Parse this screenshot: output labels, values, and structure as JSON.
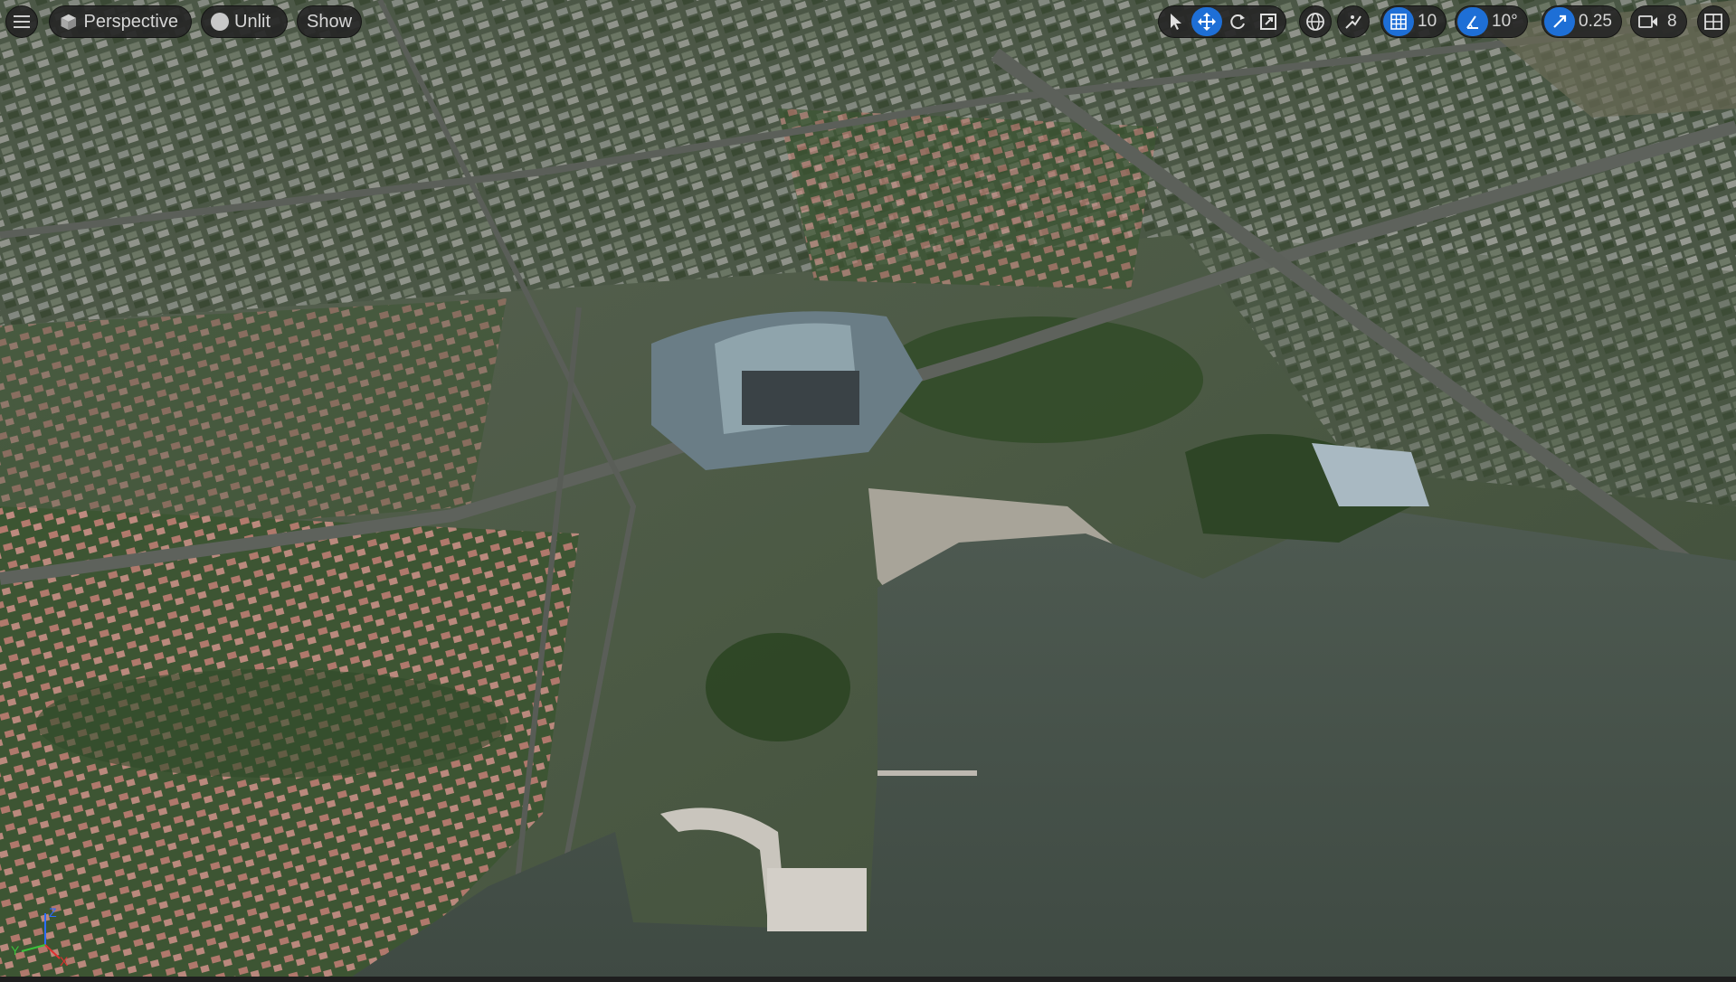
{
  "toolbar": {
    "menu_icon": "hamburger-menu-icon",
    "view_mode": {
      "icon": "cube-icon",
      "label": "Perspective"
    },
    "lighting": {
      "icon": "sphere-icon",
      "label": "Unlit"
    },
    "show_label": "Show",
    "transform_tools": [
      "select-arrow-icon",
      "move-icon",
      "rotate-icon",
      "scale-icon"
    ],
    "world_local_icon": "globe-icon",
    "surface_snap_icon": "surface-snap-icon",
    "grid_snap": {
      "icon": "grid-icon",
      "value": "10"
    },
    "rotation_snap": {
      "icon": "angle-icon",
      "value": "10°"
    },
    "scale_snap": {
      "icon": "scale-snap-icon",
      "value": "0.25"
    },
    "camera_speed": {
      "icon": "camera-icon",
      "value": "8"
    },
    "layout_icon": "viewport-layout-icon"
  },
  "axis_gizmo": {
    "z": "Z",
    "y": "Y",
    "x": "X"
  },
  "colors": {
    "accent": "#1e6fd6",
    "toolbar_bg": "#262626",
    "water": "#46524a"
  }
}
